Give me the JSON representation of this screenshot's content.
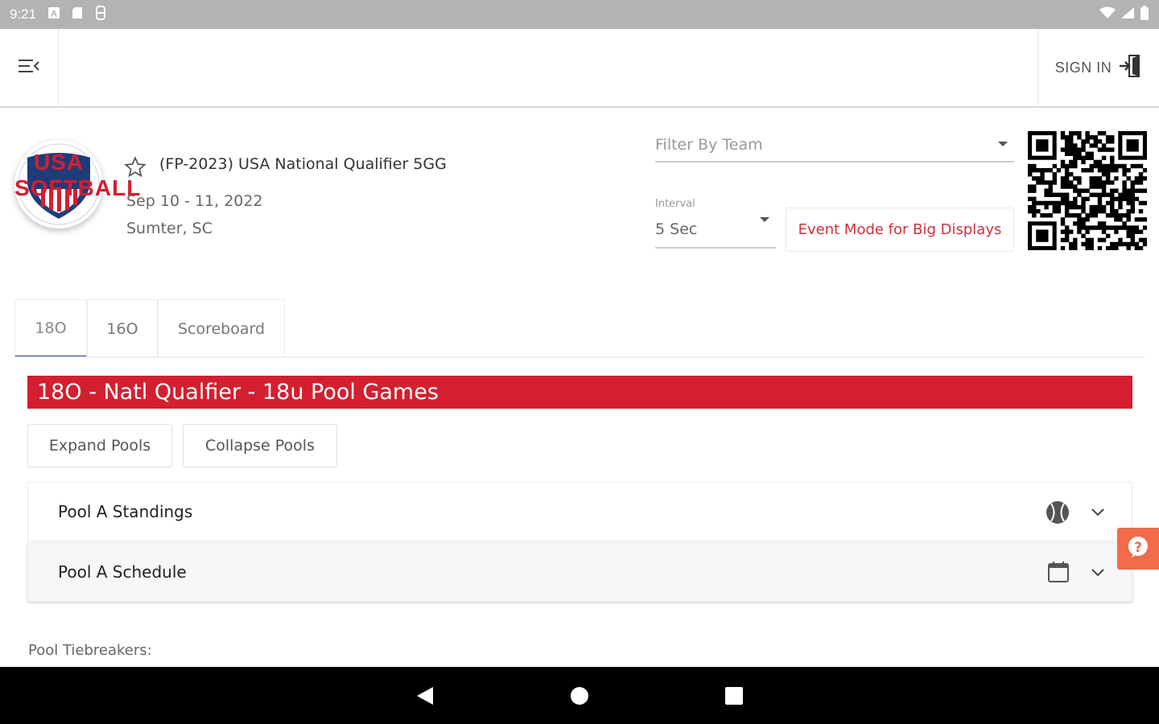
{
  "status_bar": {
    "time": "9:21"
  },
  "app_bar": {
    "sign_in_label": "SIGN IN"
  },
  "event": {
    "title": "(FP-2023) USA National Qualifier 5GG",
    "date": "Sep 10 - 11, 2022",
    "location": "Sumter, SC",
    "logo_text": "USA SOFTBALL"
  },
  "controls": {
    "filter_placeholder": "Filter By Team",
    "interval_label": "Interval",
    "interval_value": "5 Sec",
    "event_mode_label": "Event Mode for Big Displays"
  },
  "tabs": [
    {
      "label": "18O",
      "active": true
    },
    {
      "label": "16O",
      "active": false
    },
    {
      "label": "Scoreboard",
      "active": false
    }
  ],
  "division": {
    "banner": "18O - Natl Qualfier - 18u Pool Games",
    "expand_label": "Expand Pools",
    "collapse_label": "Collapse Pools",
    "panels": [
      {
        "title": "Pool A Standings",
        "icon": "softball-icon"
      },
      {
        "title": "Pool A Schedule",
        "icon": "calendar-icon"
      }
    ],
    "tiebreakers_label": "Pool Tiebreakers:"
  },
  "colors": {
    "accent_red": "#d41f30",
    "tab_indicator": "#1f3c7a",
    "help_button": "#f26b4a"
  }
}
